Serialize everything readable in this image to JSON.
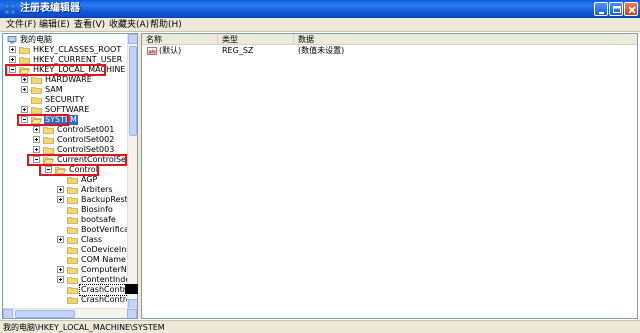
{
  "window": {
    "title": "注册表编辑器",
    "buttons": [
      "minimize",
      "maximize",
      "close"
    ]
  },
  "menu": {
    "items": [
      "文件(F)",
      "编辑(E)",
      "查看(V)",
      "收藏夹(A)",
      "帮助(H)"
    ]
  },
  "tree": {
    "nodes": [
      {
        "label": "我的电脑",
        "icon": "computer-icon"
      },
      {
        "label": "HKEY_CLASSES_ROOT",
        "icon": "folder-icon"
      },
      {
        "label": "HKEY_CURRENT_USER",
        "icon": "folder-icon"
      },
      {
        "label": "HKEY_LOCAL_MACHINE",
        "icon": "folder-open-icon"
      },
      {
        "label": "HARDWARE",
        "icon": "folder-icon"
      },
      {
        "label": "SAM",
        "icon": "folder-icon"
      },
      {
        "label": "SECURITY",
        "icon": "folder-icon"
      },
      {
        "label": "SOFTWARE",
        "icon": "folder-icon"
      },
      {
        "label": "SYSTEM",
        "icon": "folder-open-icon"
      },
      {
        "label": "ControlSet001",
        "icon": "folder-icon"
      },
      {
        "label": "ControlSet002",
        "icon": "folder-icon"
      },
      {
        "label": "ControlSet003",
        "icon": "folder-icon"
      },
      {
        "label": "CurrentControlSet",
        "icon": "folder-open-icon"
      },
      {
        "label": "Control",
        "icon": "folder-open-icon"
      },
      {
        "label": "AGP",
        "icon": "folder-icon"
      },
      {
        "label": "Arbiters",
        "icon": "folder-icon"
      },
      {
        "label": "BackupRestore",
        "icon": "folder-icon"
      },
      {
        "label": "Biosinfo",
        "icon": "folder-icon"
      },
      {
        "label": "bootsafe",
        "icon": "folder-icon"
      },
      {
        "label": "BootVerificat",
        "icon": "folder-icon"
      },
      {
        "label": "Class",
        "icon": "folder-icon"
      },
      {
        "label": "CoDeviceInsta",
        "icon": "folder-icon"
      },
      {
        "label": "COM Name Arbi",
        "icon": "folder-icon"
      },
      {
        "label": "ComputerName",
        "icon": "folder-icon"
      },
      {
        "label": "ContentIndex",
        "icon": "folder-icon"
      },
      {
        "label": "CrashControl",
        "icon": "folder-icon"
      },
      {
        "label": "CrashControl",
        "icon": "folder-icon"
      }
    ]
  },
  "list": {
    "columns": [
      "名称",
      "类型",
      "数据"
    ],
    "rows": [
      {
        "name": "(默认)",
        "type": "REG_SZ",
        "data": "(数值未设置)",
        "icon": "string-value-icon"
      }
    ]
  },
  "status": {
    "path": "我的电脑\\HKEY_LOCAL_MACHINE\\SYSTEM"
  },
  "colors": {
    "highlight": "#e0141e",
    "selection": "#316ac5",
    "titlebar": "#0a5ce0",
    "chrome": "#ece9d8"
  }
}
